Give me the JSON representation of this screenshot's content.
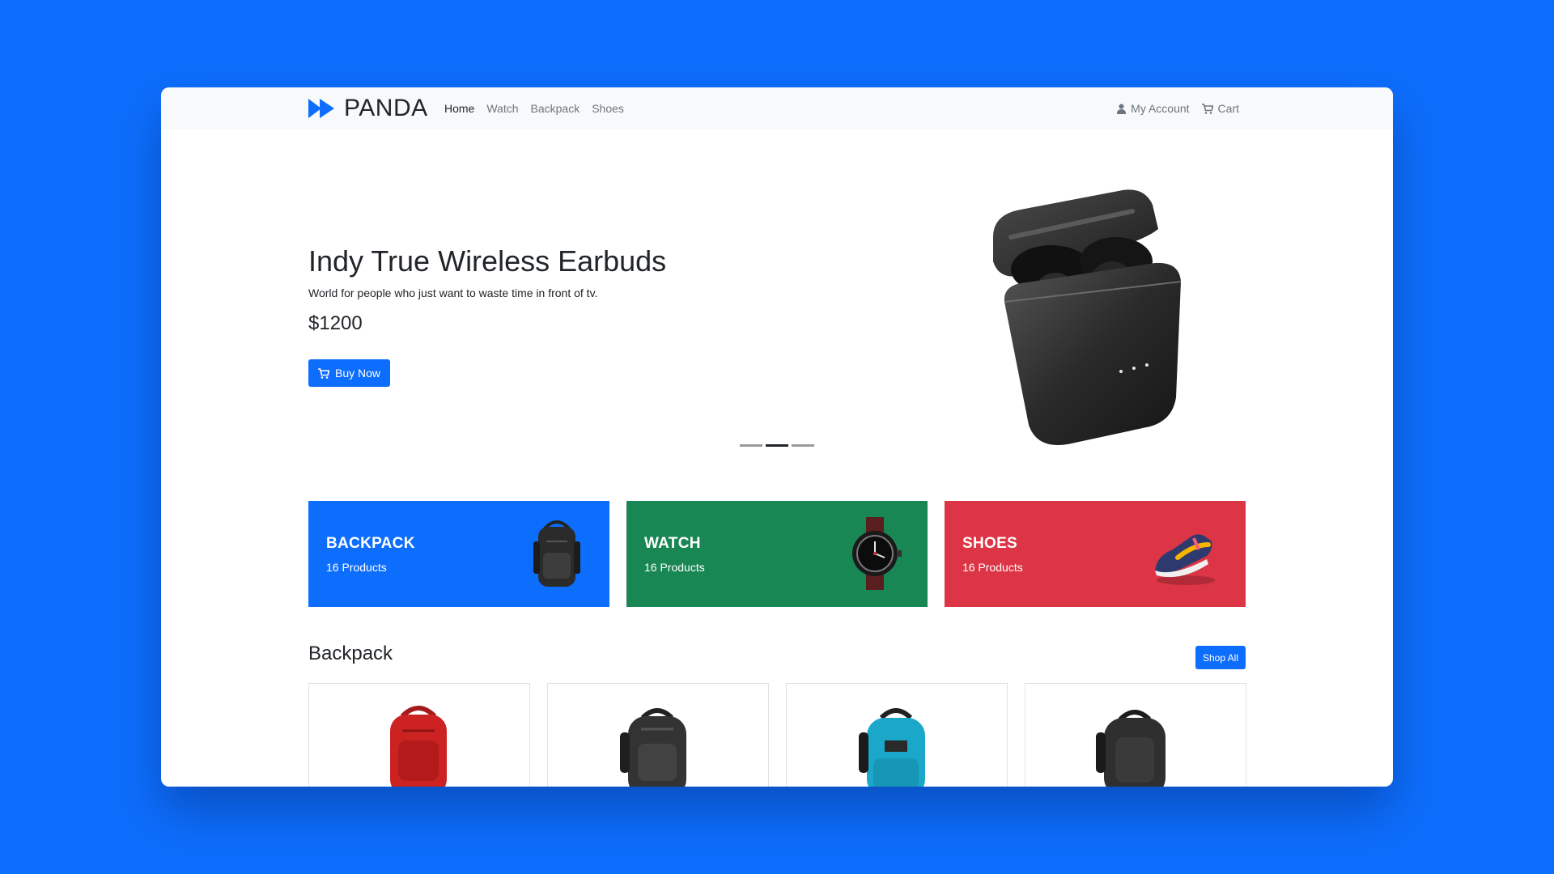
{
  "navbar": {
    "brand": "PANDA",
    "links": [
      "Home",
      "Watch",
      "Backpack",
      "Shoes"
    ],
    "account_label": "My Account",
    "cart_label": "Cart"
  },
  "hero": {
    "title": "Indy True Wireless Earbuds",
    "subtitle": "World for people who just want to waste time in front of tv.",
    "price": "$1200",
    "button_label": "Buy Now",
    "slides": 3,
    "active_slide": 2
  },
  "categories": [
    {
      "name": "BACKPACK",
      "count": "16 Products",
      "color": "#0d6efd"
    },
    {
      "name": "WATCH",
      "count": "16 Products",
      "color": "#198754"
    },
    {
      "name": "SHOES",
      "count": "16 Products",
      "color": "#dc3545"
    }
  ],
  "section": {
    "title": "Backpack",
    "button_label": "Shop All"
  },
  "products": [
    {
      "icon": "red-backpack-image",
      "color": "#cc2222"
    },
    {
      "icon": "black-backpack-image",
      "color": "#333333"
    },
    {
      "icon": "teal-backpack-image",
      "color": "#1aa7c9"
    },
    {
      "icon": "black-backpack-image",
      "color": "#2f2f2f"
    }
  ],
  "colors": {
    "accent": "#0d6efd",
    "navbar_bg": "#f8f9fa"
  }
}
